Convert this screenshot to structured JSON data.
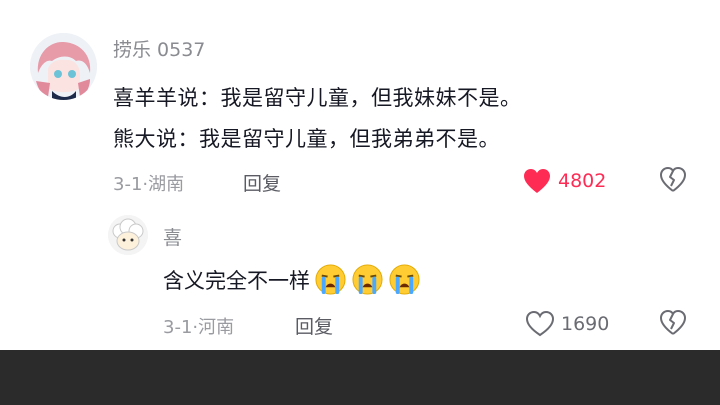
{
  "comment": {
    "username": "捞乐 0537",
    "lines": [
      "喜羊羊说：我是留守儿童，但我妹妹不是。",
      "熊大说：我是留守儿童，但我弟弟不是。"
    ],
    "date": "3-1",
    "location": "湖南",
    "reply_label": "回复",
    "like_count": "4802",
    "liked": true,
    "like_color": "#fe2c55"
  },
  "reply": {
    "username": "喜",
    "text": "含义完全不一样",
    "emoji_icons": [
      "crying-face-icon",
      "crying-face-icon",
      "crying-face-icon"
    ],
    "date": "3-1",
    "location": "河南",
    "reply_label": "回复",
    "like_count": "1690",
    "liked": false
  }
}
